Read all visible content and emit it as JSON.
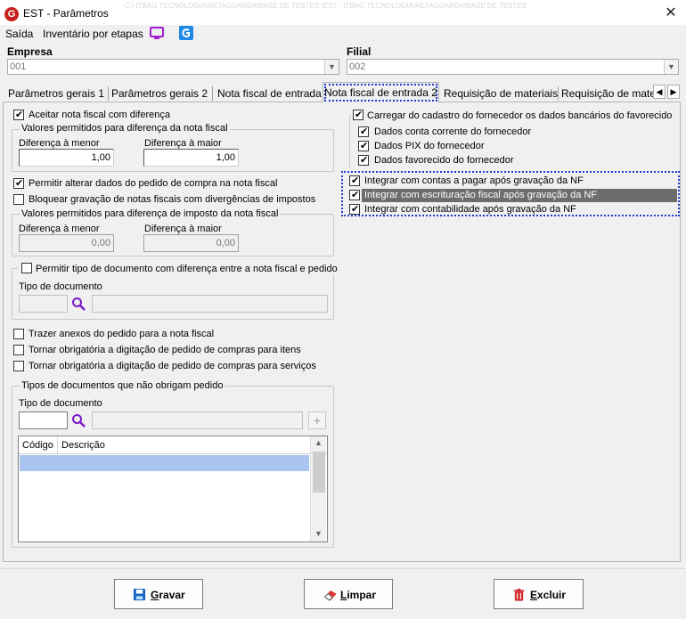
{
  "window": {
    "title": "EST - Parâmetros",
    "faded_header": "C:\\ ITBAG TECNOLOGIA\\RETAGUARDA\\BASE DE TESTES \\EST - ITBAG TECNOLOGIA\\RETAGUARDA\\BASE DE TESTES",
    "close_glyph": "✕"
  },
  "menu": {
    "items": [
      "Saída",
      "Inventário por etapas"
    ]
  },
  "empresa": {
    "label": "Empresa",
    "value": "001"
  },
  "filial": {
    "label": "Filial",
    "value": "002"
  },
  "tabs": [
    "Parâmetros gerais 1",
    "Parâmetros gerais 2",
    "Nota fiscal de entrada",
    "Nota fiscal de entrada 2",
    "Requisição de materiais",
    "Requisição de materi"
  ],
  "left": {
    "aceitar_nf": {
      "label": "Aceitar nota fiscal com diferença",
      "checked": true
    },
    "grupo_valores_nf": {
      "title": "Valores permitidos para diferença da nota fiscal",
      "menor_label": "Diferença à menor",
      "menor_value": "1,00",
      "maior_label": "Diferença à maior",
      "maior_value": "1,00"
    },
    "permitir_alterar": {
      "label": "Permitir alterar dados do pedido de compra na nota fiscal",
      "checked": true
    },
    "bloquear_gravacao": {
      "label": "Bloquear gravação de notas fiscais com divergências de impostos",
      "checked": false
    },
    "grupo_valores_imposto": {
      "title": "Valores permitidos para diferença de imposto da nota fiscal",
      "menor_label": "Diferença à menor",
      "menor_value": "0,00",
      "maior_label": "Diferença à maior",
      "maior_value": "0,00"
    },
    "grupo_tipo_doc": {
      "title": "Permitir tipo de documento com diferença entre a nota fiscal e pedido",
      "checked": false,
      "tipo_label": "Tipo de documento"
    },
    "trazer_anexos": {
      "label": "Trazer anexos do pedido para a nota fiscal",
      "checked": false
    },
    "obrig_itens": {
      "label": "Tornar obrigatória a digitação de pedido de compras para itens",
      "checked": false
    },
    "obrig_servicos": {
      "label": "Tornar obrigatória a digitação de pedido de compras para serviços",
      "checked": false
    },
    "grupo_tipos_nao_obrigam": {
      "title": "Tipos de documentos que não obrigam pedido",
      "tipo_label": "Tipo de documento",
      "grid_columns": [
        "Código",
        "Descrição"
      ]
    }
  },
  "right": {
    "carregar_cadastro": {
      "label": "Carregar do cadastro do fornecedor os dados bancários do favorecido",
      "checked": true
    },
    "dados_conta": {
      "label": "Dados conta corrente do fornecedor",
      "checked": true
    },
    "dados_pix": {
      "label": "Dados PIX do fornecedor",
      "checked": true
    },
    "dados_favorecido": {
      "label": "Dados favorecido do fornecedor",
      "checked": true
    },
    "integrar_pagar": {
      "label": "Integrar com contas a pagar após gravação da NF",
      "checked": true
    },
    "integrar_fiscal": {
      "label": "Integrar com escrituração fiscal após gravação da NF",
      "checked": true
    },
    "integrar_contab": {
      "label": "Integrar com contabilidade após gravação da NF",
      "checked": true
    }
  },
  "buttons": {
    "gravar": {
      "hotkey": "G",
      "rest": "ravar"
    },
    "limpar": {
      "hotkey": "L",
      "rest": "impar"
    },
    "excluir": {
      "hotkey": "E",
      "rest": "xcluir"
    }
  },
  "colors": {
    "accent_focus": "#1f3bd1",
    "selected_row": "#a9c4ee",
    "search_icon": "#7a18c9",
    "app_icon": "#c8201e"
  }
}
